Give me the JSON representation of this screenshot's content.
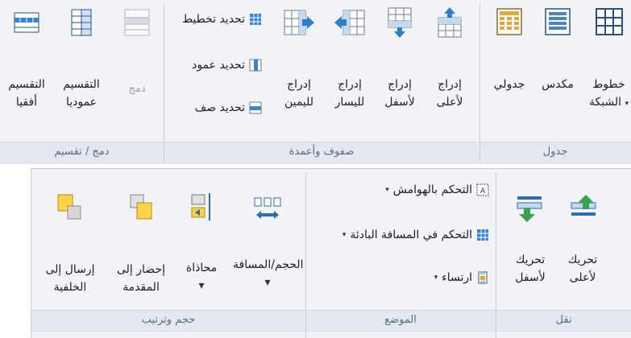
{
  "ribbon_top": {
    "groups": {
      "table": "جدول",
      "rows_cols": "صفوف وأعمدة",
      "merge": "دمج / تقسيم"
    },
    "gridlines": {
      "line1": "خطوط",
      "line2": "الشبكة",
      "arrow": "▾"
    },
    "stacked": "مكدس",
    "tabular": "جدولي",
    "insert_above": {
      "line1": "إدراج",
      "line2": "لأعلى"
    },
    "insert_below": {
      "line1": "إدراج",
      "line2": "لأسفل"
    },
    "insert_left": {
      "line1": "إدراج",
      "line2": "لليسار"
    },
    "insert_right": {
      "line1": "إدراج",
      "line2": "لليمين"
    },
    "select_layout": "تحديد تخطيط",
    "select_column": "تحديد عمود",
    "select_row": "تحديد صف",
    "merge": "دمج",
    "split_vertical": {
      "line1": "التقسيم",
      "line2": "عموديا"
    },
    "split_horizontal": {
      "line1": "التقسيم",
      "line2": "أفقيا"
    }
  },
  "ribbon_bottom": {
    "groups": {
      "move": "نقل",
      "position": "الموضع",
      "size_order": "حجم وترتيب"
    },
    "move_up": {
      "line1": "تحريك",
      "line2": "لأعلى"
    },
    "move_down": {
      "line1": "تحريك",
      "line2": "لأسفل"
    },
    "control_margins": "التحكم بالهوامش",
    "control_padding": "التحكم في المسافة البادئة",
    "anchoring": "ارتساء",
    "size_space": {
      "line1": "الحجم/المسافة",
      "arrow": "▾"
    },
    "align": {
      "line1": "محاذاة",
      "arrow": "▾"
    },
    "bring_front": {
      "line1": "إحضار إلى",
      "line2": "المقدمة"
    },
    "send_back": {
      "line1": "إرسال إلى",
      "line2": "الخلفية"
    },
    "dropdown_arrow": "▾"
  },
  "colors": {
    "accent": "#2b6cb8",
    "label_bar": "#e3e8f0",
    "ribbon_bg": "#f1f3f7"
  }
}
